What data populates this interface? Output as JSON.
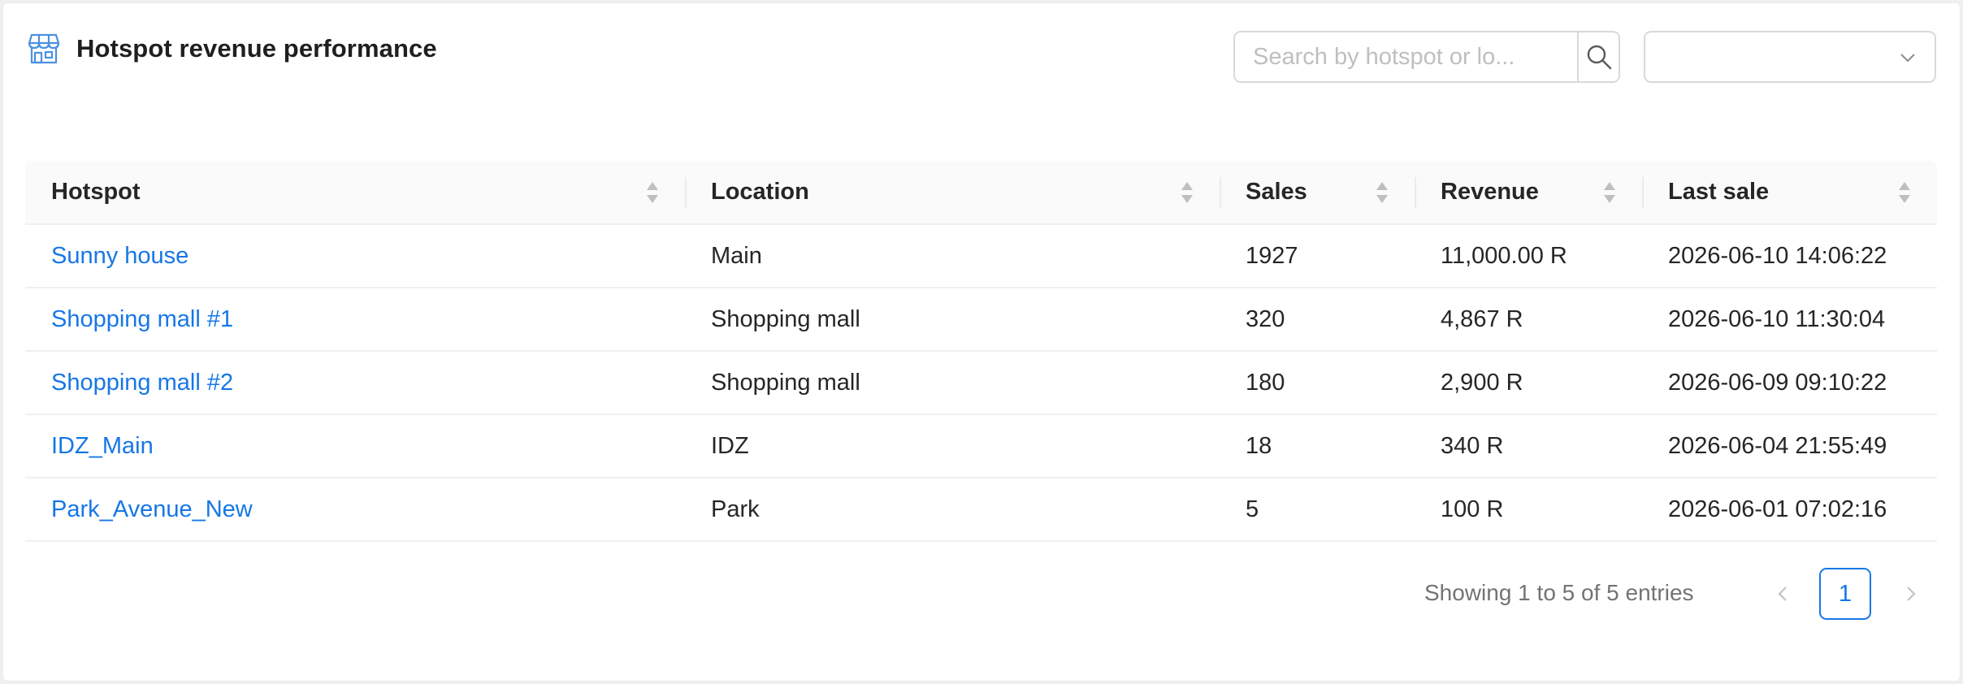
{
  "header": {
    "title": "Hotspot revenue performance",
    "icon": "store-icon"
  },
  "search": {
    "placeholder": "Search by hotspot or lo...",
    "value": ""
  },
  "filter_select": {
    "value": ""
  },
  "table": {
    "columns": [
      "Hotspot",
      "Location",
      "Sales",
      "Revenue",
      "Last sale"
    ],
    "rows": [
      {
        "hotspot": "Sunny house",
        "location": "Main",
        "sales": "1927",
        "revenue": "11,000.00 R",
        "last_sale": "2026-06-10 14:06:22"
      },
      {
        "hotspot": "Shopping mall #1",
        "location": "Shopping mall",
        "sales": "320",
        "revenue": "4,867 R",
        "last_sale": "2026-06-10 11:30:04"
      },
      {
        "hotspot": "Shopping mall #2",
        "location": "Shopping mall",
        "sales": "180",
        "revenue": "2,900 R",
        "last_sale": "2026-06-09 09:10:22"
      },
      {
        "hotspot": "IDZ_Main",
        "location": "IDZ",
        "sales": "18",
        "revenue": "340 R",
        "last_sale": "2026-06-04 21:55:49"
      },
      {
        "hotspot": "Park_Avenue_New",
        "location": "Park",
        "sales": "5",
        "revenue": "100 R",
        "last_sale": "2026-06-01 07:02:16"
      }
    ]
  },
  "pagination": {
    "info": "Showing 1 to 5 of 5 entries",
    "current_page": "1"
  },
  "colors": {
    "link": "#1677e6",
    "header_bg": "#fafafa",
    "border": "#d9d9d9",
    "icon_accent": "#4a90e2"
  }
}
